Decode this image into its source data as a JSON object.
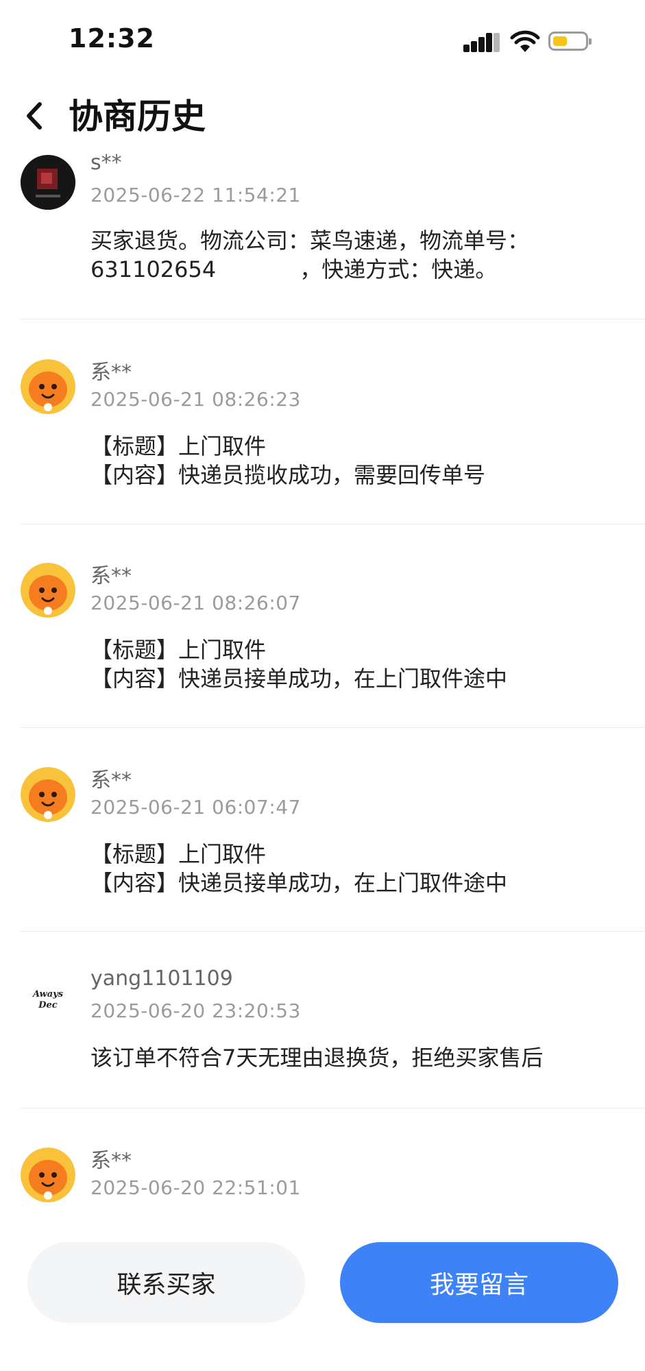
{
  "status_bar": {
    "time": "12:32",
    "battery_level": 0.45,
    "battery_color": "#f5c518"
  },
  "header": {
    "title": "协商历史"
  },
  "entries": [
    {
      "name": "s**",
      "time": "2025-06-22 11:54:21",
      "lines": [
        "买家退货。物流公司：菜鸟速递，物流单号：",
        "631102654            ，快递方式：快递。"
      ],
      "avatar": "dark-photo"
    },
    {
      "name": "系**",
      "time": "2025-06-21 08:26:23",
      "lines": [
        "【标题】上门取件",
        "【内容】快递员揽收成功，需要回传单号"
      ],
      "avatar": "orange-mascot"
    },
    {
      "name": "系**",
      "time": "2025-06-21 08:26:07",
      "lines": [
        "【标题】上门取件",
        "【内容】快递员接单成功，在上门取件途中"
      ],
      "avatar": "orange-mascot"
    },
    {
      "name": "系**",
      "time": "2025-06-21 06:07:47",
      "lines": [
        "【标题】上门取件",
        "【内容】快递员接单成功，在上门取件途中"
      ],
      "avatar": "orange-mascot"
    },
    {
      "name": "yang1101109",
      "time": "2025-06-20 23:20:53",
      "lines": [
        "该订单不符合7天无理由退换货，拒绝买家售后"
      ],
      "avatar": "handwritten-text",
      "avatar_text": [
        "Aways",
        "Dec"
      ]
    },
    {
      "name": "系**",
      "time": "2025-06-20 22:51:01",
      "lines": [],
      "avatar": "orange-mascot"
    }
  ],
  "buttons": {
    "contact": "联系买家",
    "message": "我要留言"
  },
  "colors": {
    "accent": "#3d82f7",
    "mascot": "#f57c1f",
    "mascot_ring": "#f8c23a"
  }
}
